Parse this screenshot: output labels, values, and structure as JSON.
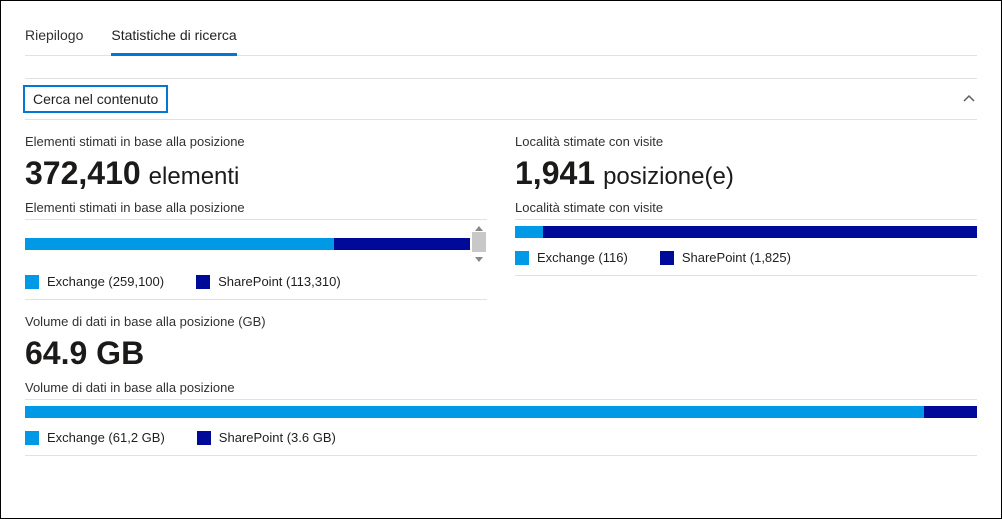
{
  "tabs": {
    "summary": "Riepilogo",
    "stats": "Statistiche di ricerca"
  },
  "collapse_header": "Cerca nel contenuto",
  "card_items": {
    "label": "Elementi stimati in base alla posizione",
    "value": "372,410",
    "unit": "elementi",
    "bar_label": "Elementi stimati in base alla posizione",
    "legend_exchange": "Exchange (259,100)",
    "legend_sharepoint": "SharePoint (113,310)"
  },
  "card_locations": {
    "label": "Località stimate con visite",
    "value": "1,941",
    "unit": "posizione(e)",
    "bar_label": "Località stimate con visite",
    "legend_exchange": "Exchange (116)",
    "legend_sharepoint": "SharePoint (1,825)"
  },
  "card_volume": {
    "label": "Volume di dati in base alla posizione (GB)",
    "value": "64.9 GB",
    "bar_label": "Volume di dati in base alla posizione",
    "legend_exchange": "Exchange (61,2 GB)",
    "legend_sharepoint": "SharePoint (3.6 GB)"
  },
  "chart_data": [
    {
      "type": "bar",
      "title": "Elementi stimati in base alla posizione",
      "categories": [
        "Exchange",
        "SharePoint"
      ],
      "values": [
        259100,
        113310
      ],
      "unit": "elementi"
    },
    {
      "type": "bar",
      "title": "Località stimate con visite",
      "categories": [
        "Exchange",
        "SharePoint"
      ],
      "values": [
        116,
        1825
      ],
      "unit": "posizione(e)"
    },
    {
      "type": "bar",
      "title": "Volume di dati in base alla posizione",
      "categories": [
        "Exchange",
        "SharePoint"
      ],
      "values": [
        61.2,
        3.6
      ],
      "unit": "GB"
    }
  ]
}
